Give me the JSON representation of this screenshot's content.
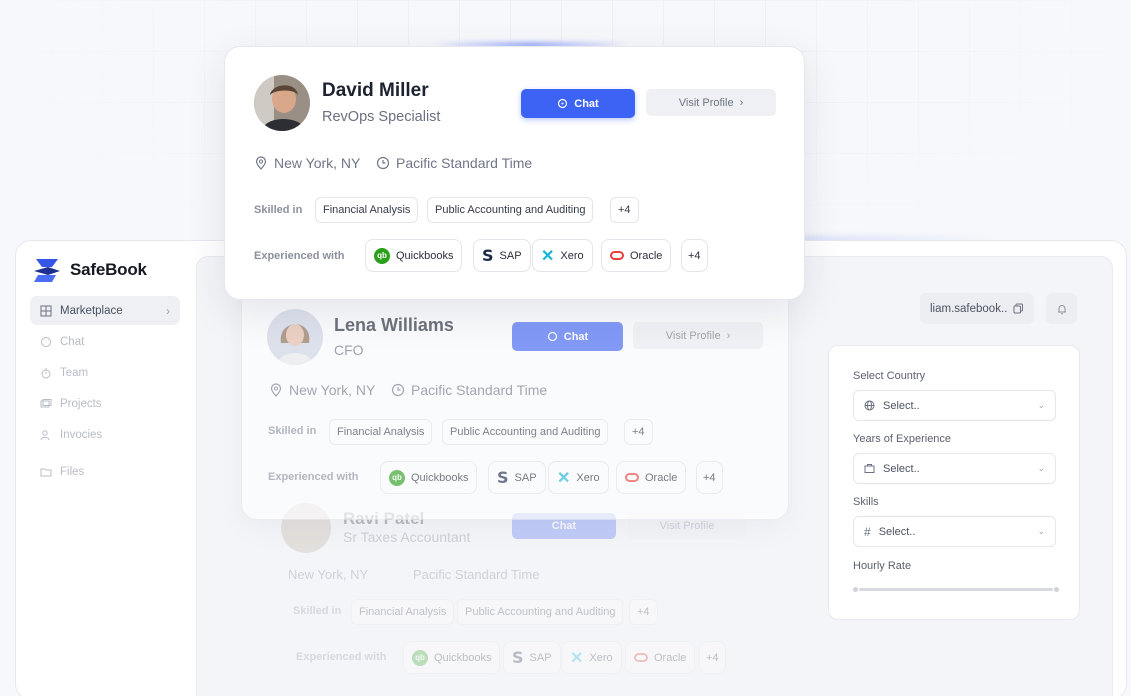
{
  "brand": {
    "name": "SafeBook"
  },
  "sidebar": {
    "items": [
      {
        "label": "Marketplace",
        "icon": "grid-icon",
        "active": true
      },
      {
        "label": "Chat",
        "icon": "chat-bubble-icon"
      },
      {
        "label": "Team",
        "icon": "stopwatch-icon"
      },
      {
        "label": "Projects",
        "icon": "folders-icon"
      },
      {
        "label": "Invocies",
        "icon": "users-icon"
      },
      {
        "label": "Files",
        "icon": "folder-icon"
      }
    ]
  },
  "header": {
    "user": "liam.safebook..",
    "copy_icon": "copy-icon",
    "bell_icon": "bell-icon"
  },
  "filters": {
    "country": {
      "label": "Select Country",
      "placeholder": "Select.."
    },
    "experience": {
      "label": "Years of Experience",
      "placeholder": "Select.."
    },
    "skills": {
      "label": "Skills",
      "placeholder": "Select.."
    },
    "rate": {
      "label": "Hourly Rate"
    }
  },
  "labels": {
    "chat": "Chat",
    "visit": "Visit Profile",
    "skilled_in": "Skilled in",
    "experienced_with": "Experienced with"
  },
  "candidates": [
    {
      "name": "David Miller",
      "role": "RevOps Specialist",
      "location": "New York, NY",
      "timezone": "Pacific Standard Time",
      "skills": [
        "Financial Analysis",
        "Public Accounting and Auditing",
        "+4"
      ],
      "tools": [
        "Quickbooks",
        "SAP",
        "Xero",
        "Oracle",
        "+4"
      ]
    },
    {
      "name": "Lena Williams",
      "role": "CFO",
      "location": "New York, NY",
      "timezone": "Pacific Standard Time",
      "skills": [
        "Financial Analysis",
        "Public Accounting and Auditing",
        "+4"
      ],
      "tools": [
        "Quickbooks",
        "SAP",
        "Xero",
        "Oracle",
        "+4"
      ]
    },
    {
      "name": "Ravi Patel",
      "role": "Sr Taxes Accountant",
      "location": "New York, NY",
      "timezone": "Pacific Standard Time",
      "skills": [
        "Financial Analysis",
        "Public Accounting and Auditing",
        "+4"
      ],
      "tools": [
        "Quickbooks",
        "SAP",
        "Xero",
        "Oracle",
        "+4"
      ]
    }
  ],
  "colors": {
    "primary": "#3d63f5",
    "qb": "#2ca01c",
    "xero": "#1ab4d7",
    "oracle": "#e8413c"
  }
}
